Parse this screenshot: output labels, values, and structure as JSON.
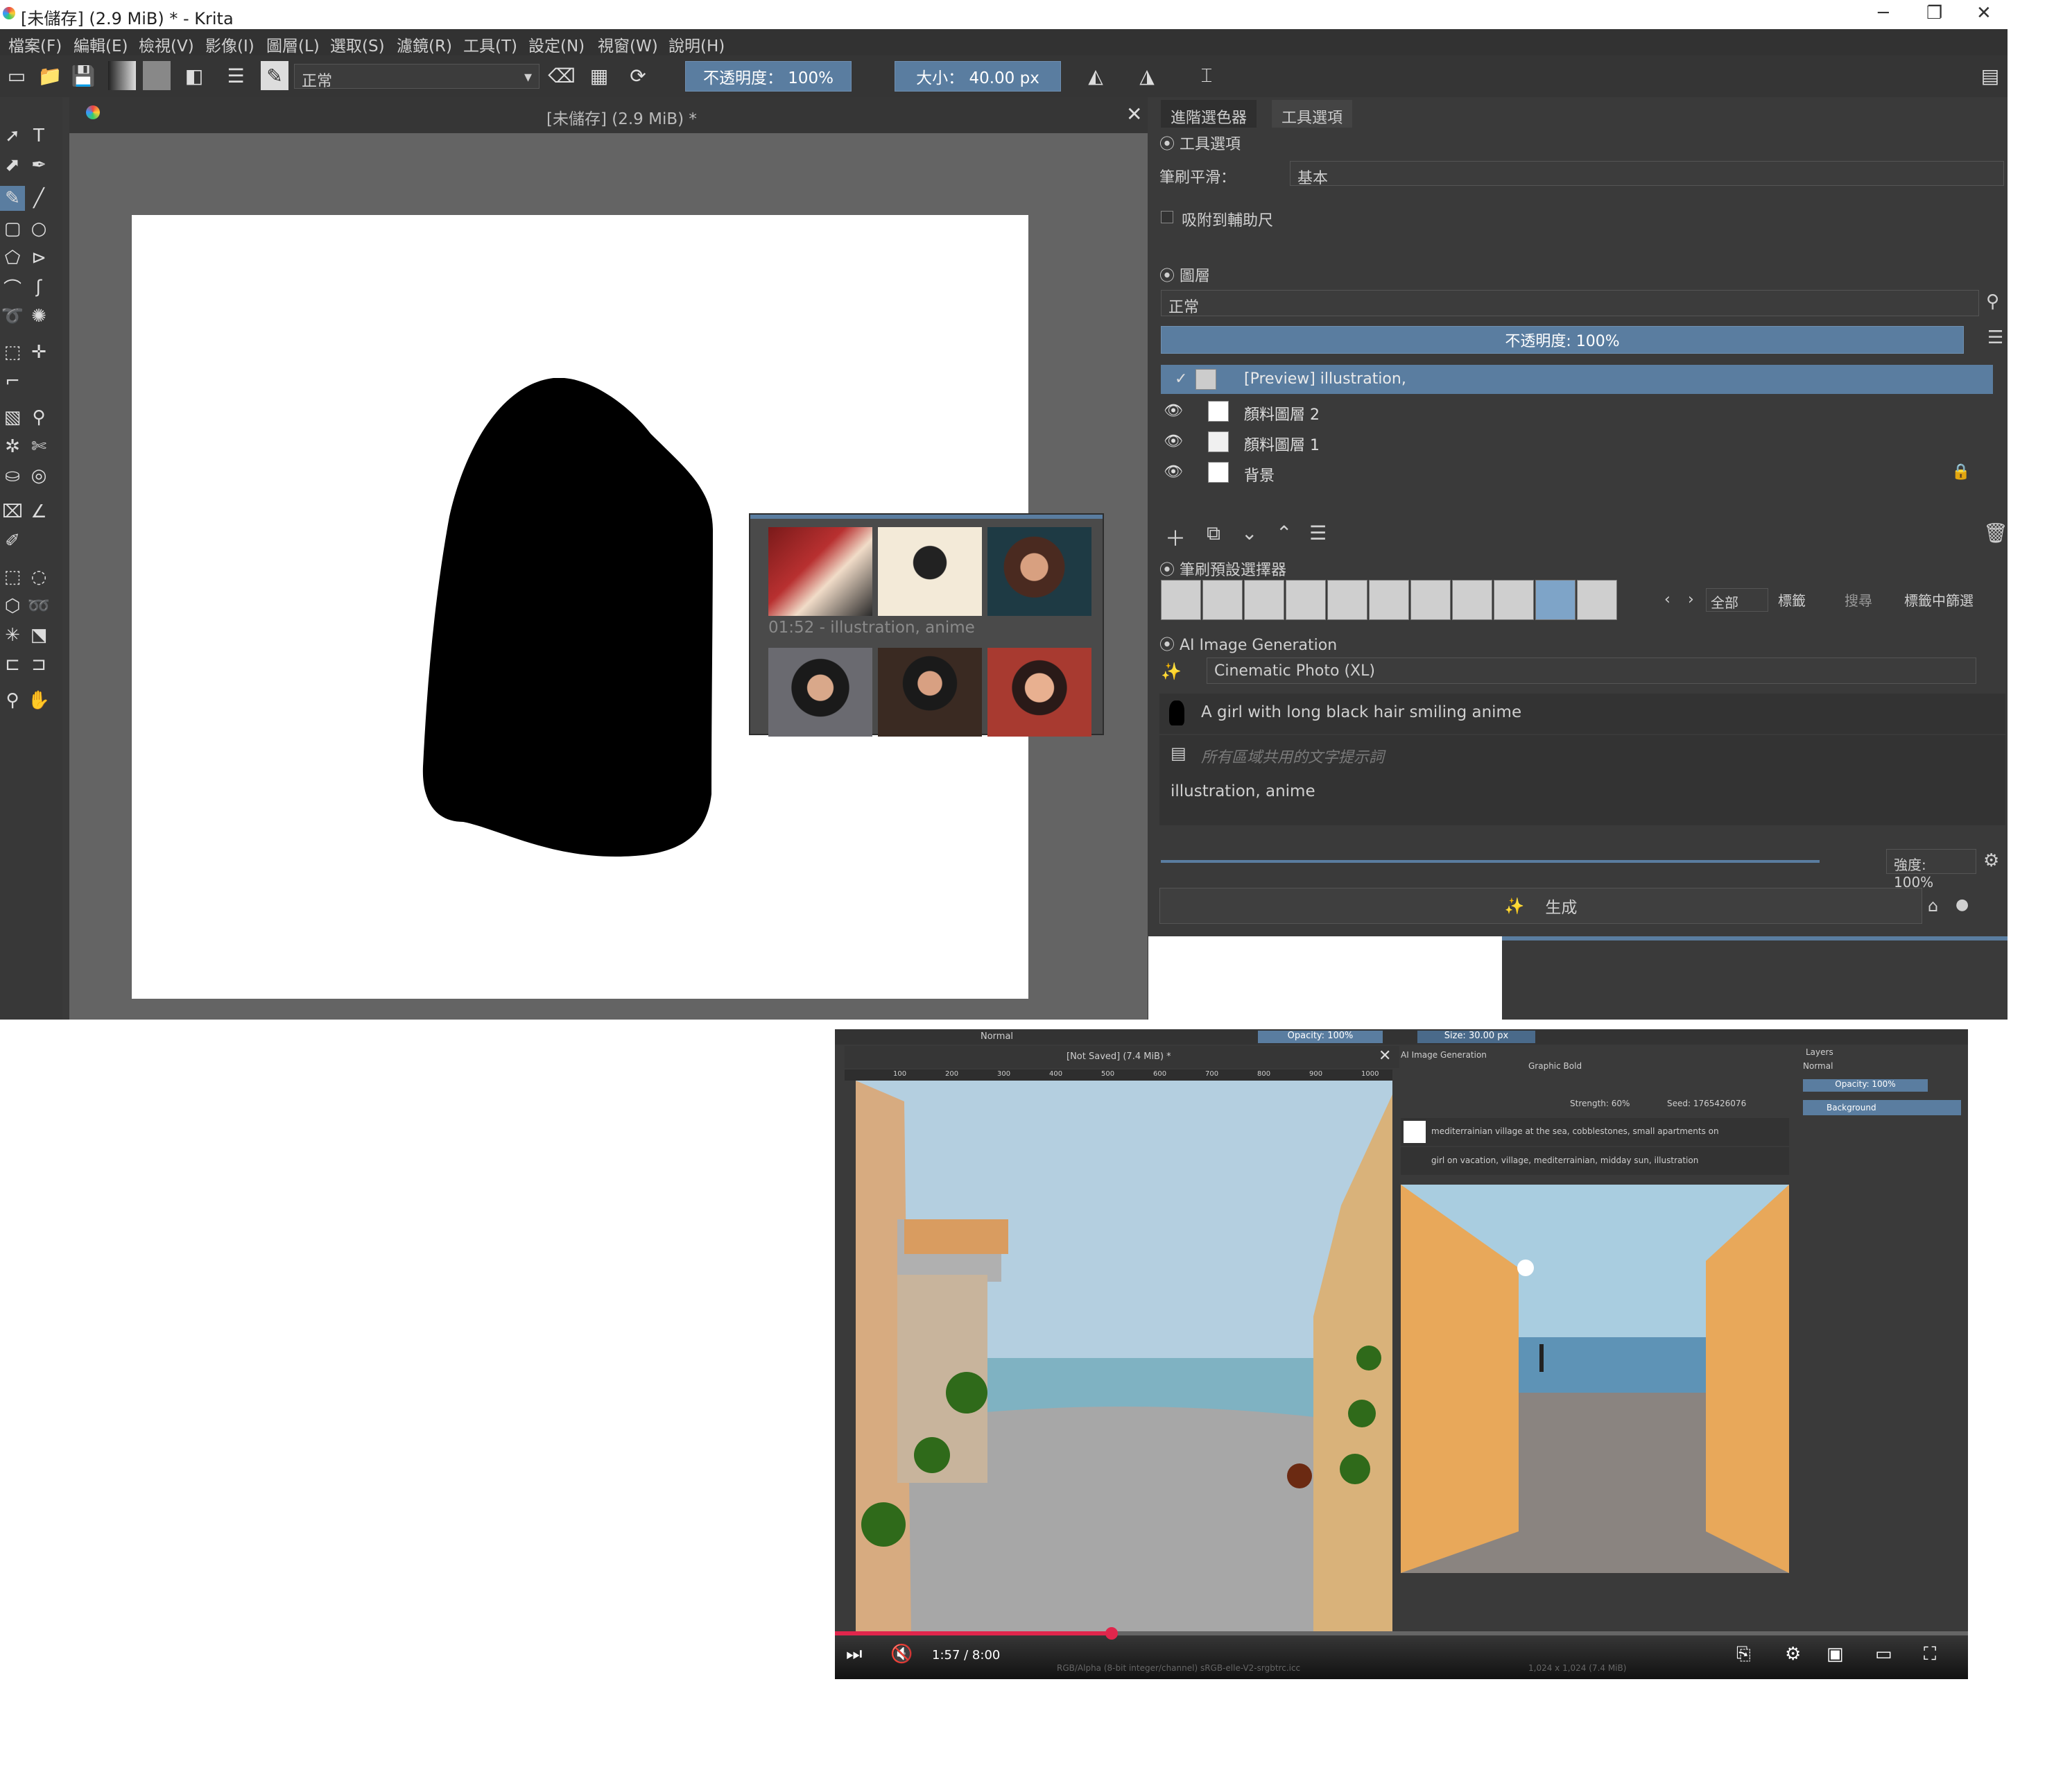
{
  "window": {
    "title": "[未儲存] (2.9 MiB) * - Krita",
    "controls": [
      "─",
      "❐",
      "✕"
    ]
  },
  "menu": [
    "檔案(F)",
    "編輯(E)",
    "檢視(V)",
    "影像(I)",
    "圖層(L)",
    "選取(S)",
    "濾鏡(R)",
    "工具(T)",
    "設定(N)",
    "視窗(W)",
    "說明(H)"
  ],
  "toolbar": {
    "blend_mode": "正常",
    "opacity": "不透明度： 100%",
    "size": "大小： 40.00 px"
  },
  "document": {
    "tab_title": "[未儲存] (2.9 MiB) *",
    "history_caption": "01:52 - illustration, anime"
  },
  "panel": {
    "tabs": [
      "進階選色器",
      "工具選項"
    ],
    "tool_options": {
      "header": "工具選項",
      "smoothing_label": "筆刷平滑：",
      "smoothing_value": "基本",
      "snap_label": "吸附到輔助尺"
    },
    "layers": {
      "header": "圖層",
      "blend": "正常",
      "opacity": "不透明度: 100%",
      "rows": [
        {
          "name": "[Preview] illustration,"
        },
        {
          "name": "顏料圖層 2"
        },
        {
          "name": "顏料圖層 1"
        },
        {
          "name": "背景"
        }
      ]
    },
    "brush_presets": {
      "header": "筆刷預設選擇器",
      "filter_all": "全部",
      "tag_label": "標籤",
      "search_label": "搜尋",
      "filter_in_tag": "標籤中篩選"
    },
    "ai": {
      "header": "AI Image Generation",
      "style": "Cinematic Photo (XL)",
      "prompt": "A girl with long black hair smiling anime",
      "shared_placeholder": "所有區域共用的文字提示詞",
      "shared_text": "illustration, anime",
      "strength": "強度: 100%",
      "generate": "生成"
    }
  },
  "video": {
    "blend": "Normal",
    "opacity": "Opacity: 100%",
    "size": "Size: 30.00 px",
    "doc_title": "[Not Saved]  (7.4 MiB) *",
    "ruler": [
      "100",
      "200",
      "300",
      "400",
      "500",
      "600",
      "700",
      "800",
      "900",
      "1000"
    ],
    "ai_header": "AI Image Generation",
    "style": "Graphic Bold",
    "strength": "Strength: 60%",
    "seed": "Seed: 1765426076",
    "prompt": "mediterrainian village at the sea, cobblestones, small apartments on",
    "shared": "girl on vacation, village, mediterrainian, midday sun, illustration",
    "layers_header": "Layers",
    "layers_blend": "Normal",
    "layers_opacity": "Opacity: 100%",
    "layer_name": "Background",
    "time": "1:57 / 8:00",
    "status": "RGB/Alpha (8-bit integer/channel)  sRGB-elle-V2-srgbtrc.icc",
    "status_right": "1,024 x 1,024 (7.4 MiB)",
    "progress": 0.244
  },
  "colors": {
    "accent": "#5a7da0",
    "panel": "#3a3a3a",
    "canvas_bg": "#646464",
    "progress_red": "#e0264c"
  }
}
